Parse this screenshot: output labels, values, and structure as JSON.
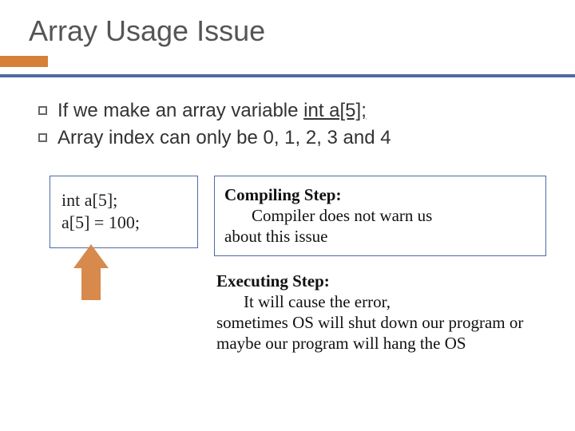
{
  "title": "Array Usage Issue",
  "bullets": {
    "b1_pre": "If we make an array variable ",
    "b1_code": "int a[5];",
    "b2": "Array index can only be 0, 1, 2, 3 and 4"
  },
  "code": {
    "l1": "int a[5];",
    "l2": "a[5] = 100;"
  },
  "note1": {
    "heading": "Compiling Step:",
    "body_indent": "Compiler does not warn us",
    "body_rest": "about this issue"
  },
  "note2": {
    "heading": "Executing Step:",
    "body_indent": "It will cause the error,",
    "body_rest": "sometimes OS will shut down our program or maybe our program will hang the OS"
  }
}
